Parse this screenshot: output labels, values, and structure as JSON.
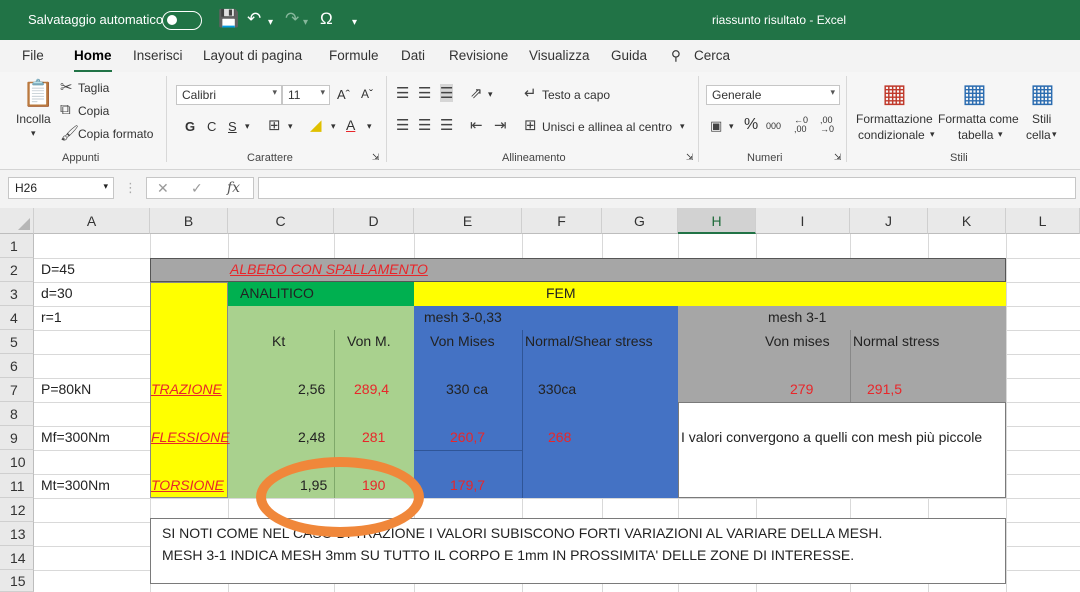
{
  "titlebar": {
    "autosave_label": "Salvataggio automatico",
    "document_title": "riassunto risultato  -  Excel"
  },
  "menu": {
    "tabs": [
      "File",
      "Home",
      "Inserisci",
      "Layout di pagina",
      "Formule",
      "Dati",
      "Revisione",
      "Visualizza",
      "Guida"
    ],
    "search_label": "Cerca",
    "active_tab": "Home"
  },
  "ribbon": {
    "clipboard": {
      "paste": "Incolla",
      "cut": "Taglia",
      "copy": "Copia",
      "format_painter": "Copia formato",
      "group": "Appunti"
    },
    "font": {
      "name": "Calibri",
      "size": "11",
      "bold": "G",
      "italic": "C",
      "underline": "S",
      "group": "Carattere"
    },
    "alignment": {
      "wrap": "Testo a capo",
      "merge": "Unisci e allinea al centro",
      "group": "Allineamento"
    },
    "number": {
      "format": "Generale",
      "group": "Numeri"
    },
    "styles": {
      "conditional_1": "Formattazione",
      "conditional_2": "condizionale",
      "table_1": "Formatta come",
      "table_2": "tabella",
      "cell_1": "Stili",
      "cell_2": "cella",
      "group": "Stili"
    }
  },
  "formula_bar": {
    "cell_ref": "H26",
    "fx": "fx",
    "value": ""
  },
  "grid": {
    "columns": [
      "A",
      "B",
      "C",
      "D",
      "E",
      "F",
      "G",
      "H",
      "I",
      "J",
      "K",
      "L"
    ],
    "selected_column": "H",
    "rows": [
      "1",
      "2",
      "3",
      "4",
      "5",
      "6",
      "7",
      "8",
      "9",
      "10",
      "11",
      "12",
      "13",
      "14",
      "15"
    ]
  },
  "cells": {
    "A2": "D=45",
    "A3": "d=30",
    "A4": "r=1",
    "A7": "P=80kN",
    "A9": "Mf=300Nm",
    "A11": "Mt=300Nm",
    "C2": "ALBERO CON SPALLAMENTO",
    "C3": "ANALITICO",
    "F3": "FEM",
    "E4": "mesh 3-0,33",
    "I4": "mesh 3-1",
    "C5": "Kt",
    "D5": "Von M.",
    "E5": "Von Mises",
    "F5": "Normal/Shear stress",
    "I5": "Von mises",
    "J5": "Normal stress",
    "B7": "TRAZIONE",
    "C7": "2,56",
    "D7": "289,4",
    "E7": "330 ca",
    "F7": "330ca",
    "I7": "279",
    "J7": "291,5",
    "B9": "FLESSIONE",
    "C9": "2,48",
    "D9": "281",
    "E9": "260,7",
    "F9": "268",
    "H9": "I valori convergono a quelli con mesh più piccole",
    "B11": "TORSIONE",
    "C11": "1,95",
    "D11": "190",
    "E11": "179,7",
    "B13": "SI NOTI COME NEL CASO DI TRAZIONE I VALORI SUBISCONO FORTI VARIAZIONI AL VARIARE DELLA MESH.",
    "B14": "MESH 3-1 INDICA MESH 3mm SU TUTTO IL CORPO E 1mm IN PROSSIMITA' DELLE ZONE DI INTERESSE."
  },
  "colors": {
    "excel_green": "#217346",
    "yellow_fill": "#ffff00",
    "green_fill": "#a9d18e",
    "dark_green_fill": "#00b050",
    "blue_fill": "#4472c4",
    "gray_fill": "#a6a6a6",
    "red_text": "#e8262a",
    "annotation_orange": "#f0873a"
  }
}
